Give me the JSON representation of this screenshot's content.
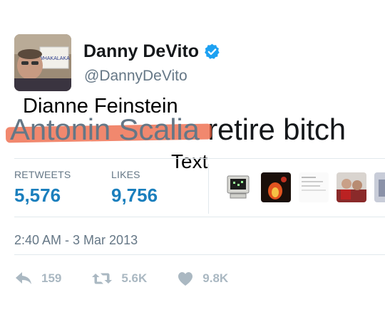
{
  "user": {
    "name": "Danny DeVito",
    "handle": "@DannyDeVito",
    "avatar_sign_text": "WHAKALAKA"
  },
  "captions": {
    "top": "Dianne Feinstein",
    "middle": "Text"
  },
  "tweet": {
    "struck_text": "Antonin Scalia",
    "text": "retire bitch"
  },
  "stats": {
    "retweets_label": "RETWEETS",
    "retweets_value": "5,576",
    "likes_label": "LIKES",
    "likes_value": "9,756"
  },
  "likers": [
    {
      "icon": "computer-avatar"
    },
    {
      "icon": "fire-avatar"
    },
    {
      "icon": "text-avatar"
    },
    {
      "icon": "people-avatar"
    },
    {
      "icon": "room-avatar"
    }
  ],
  "timestamp": "2:40 AM - 3 Mar 2013",
  "actions": {
    "reply_count": "159",
    "retweet_count": "5.6K",
    "like_count": "9.8K"
  },
  "colors": {
    "highlight": "#ec603e",
    "link": "#1b7fbd",
    "secondary": "#657786",
    "action_icon": "#aab8c2",
    "verified": "#1da1f2"
  }
}
